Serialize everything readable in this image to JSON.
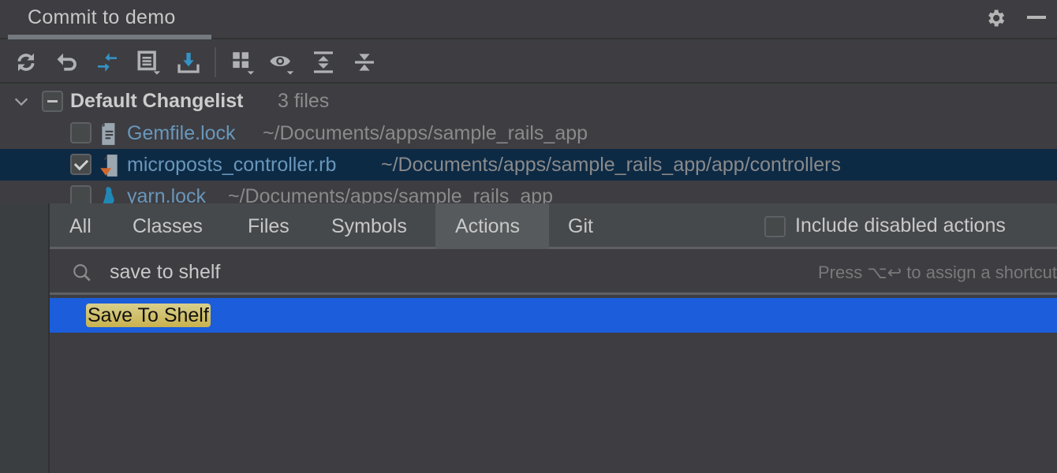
{
  "header": {
    "tab_title": "Commit to demo",
    "icons": [
      "gear-icon",
      "minimize-icon"
    ]
  },
  "toolbar": {
    "icons": [
      {
        "name": "refresh-icon",
        "color": "#afb1b3"
      },
      {
        "name": "rollback-icon",
        "color": "#afb1b3"
      },
      {
        "name": "show-diff-icon",
        "color": "#3592c4"
      },
      {
        "name": "changelist-menu-icon",
        "color": "#afb1b3"
      },
      {
        "name": "update-icon",
        "color": "#3592c4"
      },
      {
        "name": "group-by-icon",
        "color": "#afb1b3"
      },
      {
        "name": "view-options-icon",
        "color": "#afb1b3"
      },
      {
        "name": "expand-all-icon",
        "color": "#afb1b3"
      },
      {
        "name": "collapse-all-icon",
        "color": "#afb1b3"
      }
    ]
  },
  "changelist": {
    "name": "Default Changelist",
    "count": "3 files",
    "files": [
      {
        "name": "Gemfile.lock",
        "path": "~/Documents/apps/sample_rails_app",
        "checked": false,
        "icon": "text-file-icon"
      },
      {
        "name": "microposts_controller.rb",
        "path": "~/Documents/apps/sample_rails_app/app/controllers",
        "checked": true,
        "icon": "ruby-file-icon",
        "selected": true
      },
      {
        "name": "yarn.lock",
        "path": "~/Documents/apps/sample_rails_app",
        "checked": false,
        "icon": "yarn-file-icon"
      }
    ]
  },
  "search_popup": {
    "tabs": [
      {
        "label": "All"
      },
      {
        "label": "Classes"
      },
      {
        "label": "Files"
      },
      {
        "label": "Symbols"
      },
      {
        "label": "Actions",
        "active": true
      },
      {
        "label": "Git"
      }
    ],
    "include_disabled_label": "Include disabled actions",
    "include_disabled_checked": false,
    "search_value": "save to shelf",
    "hint": "Press ⌥↩ to assign a shortcut",
    "results": [
      {
        "label": "Save To Shelf",
        "selected": true
      }
    ],
    "colors": {
      "selection": "#1b5ddb",
      "match_highlight": "#c9b24e"
    }
  }
}
